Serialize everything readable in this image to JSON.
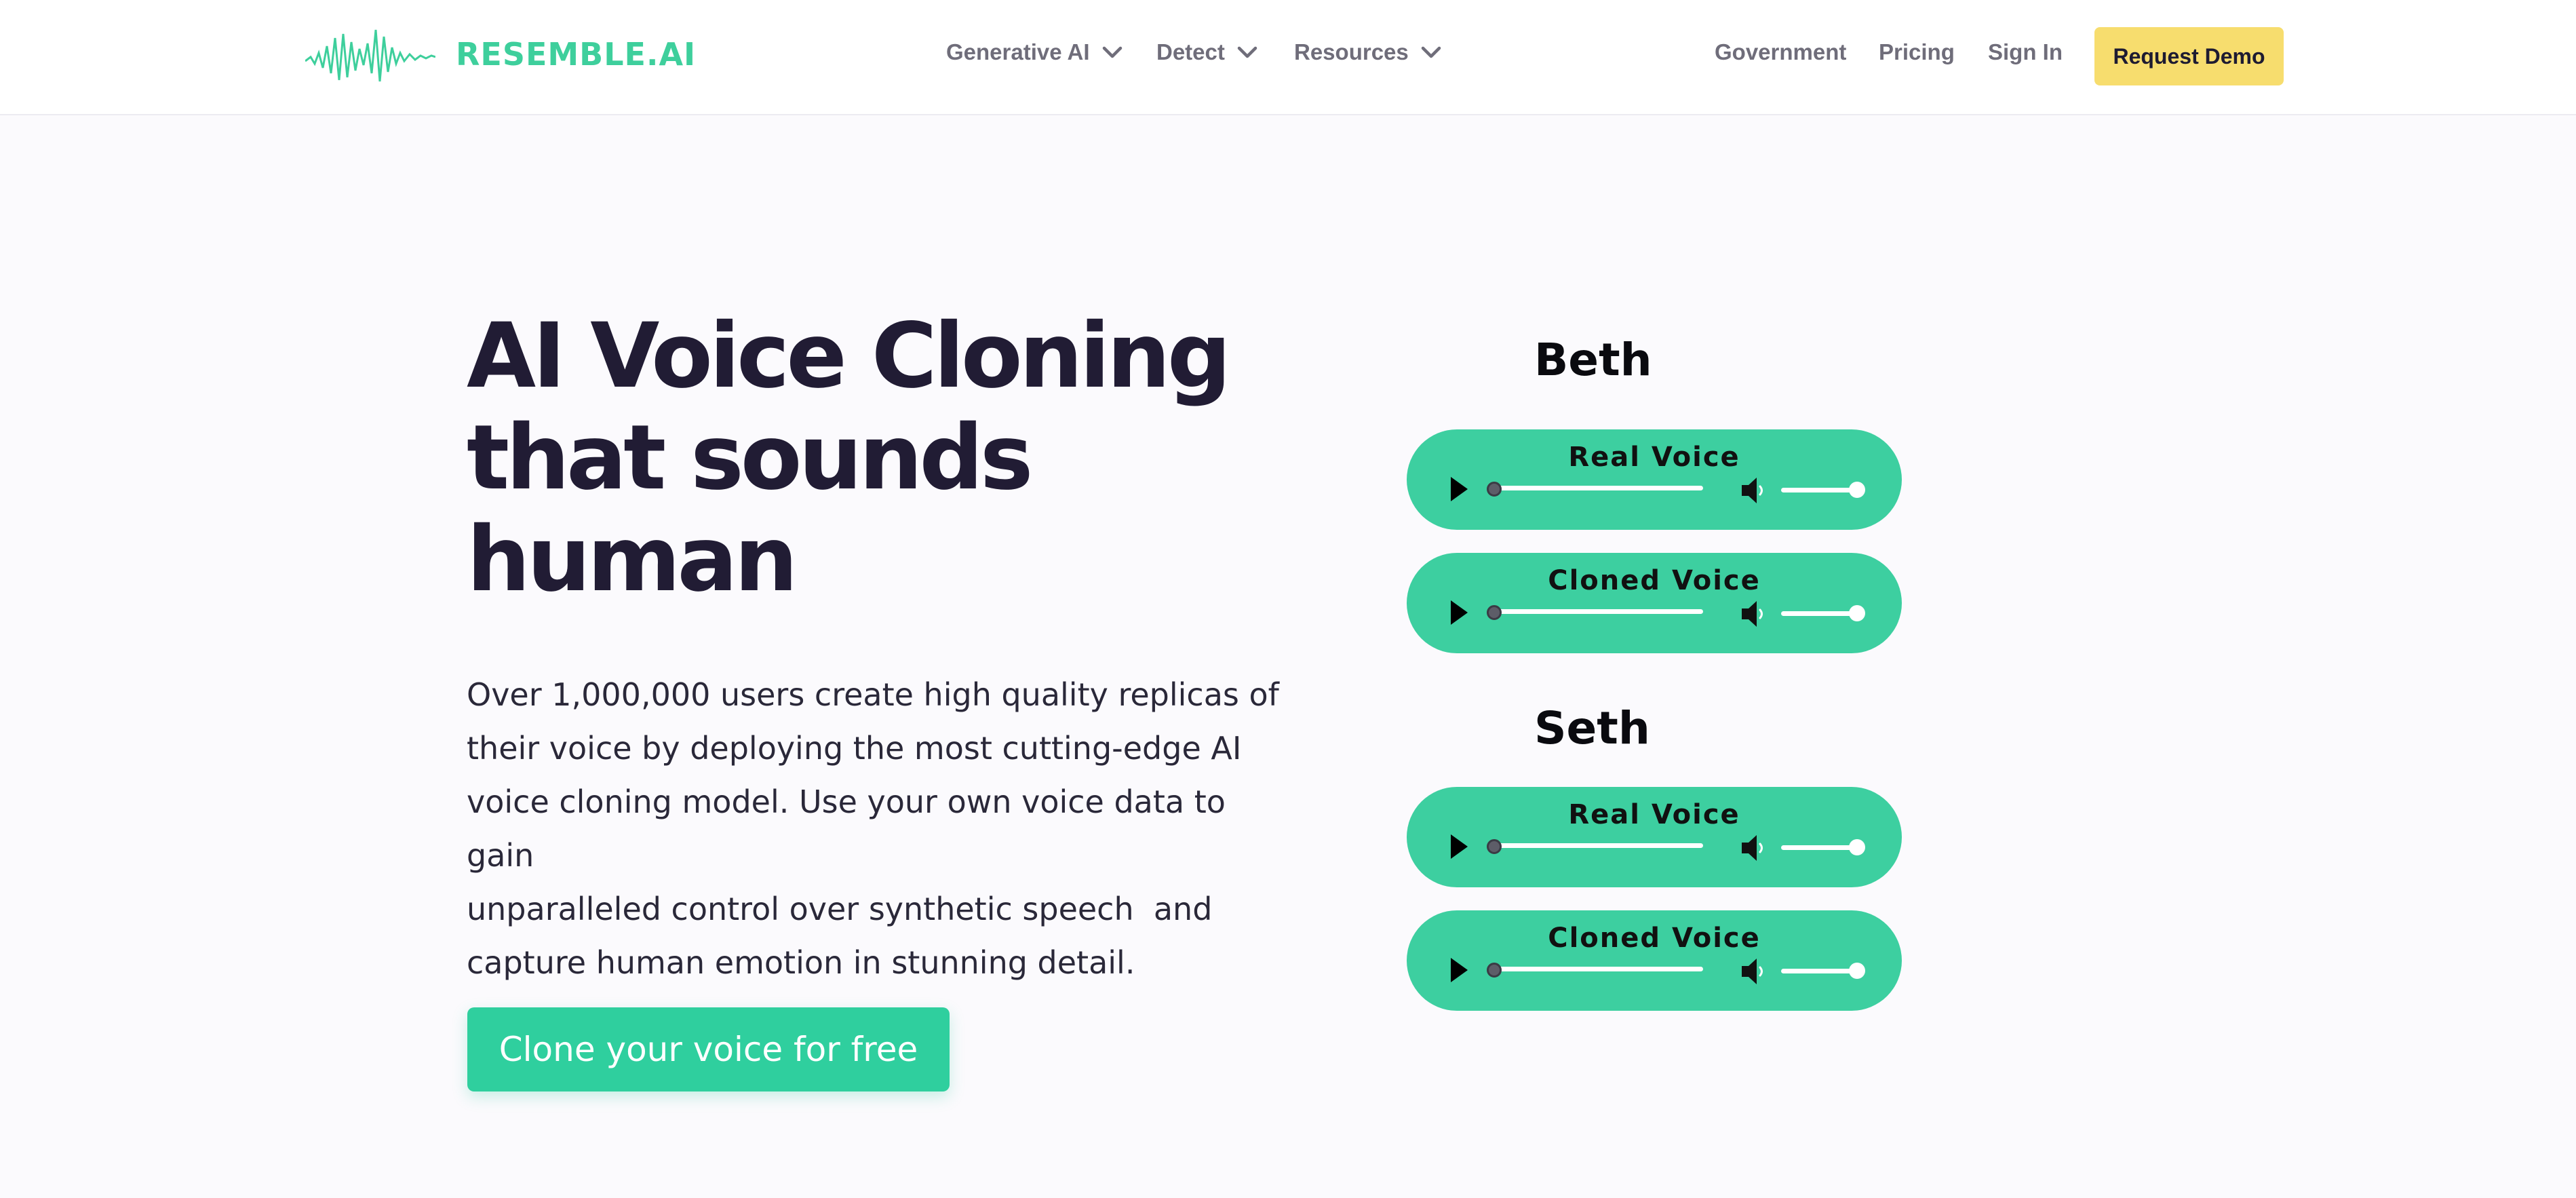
{
  "brand": {
    "name": "RESEMBLE.AI",
    "accent_color": "#3ecf9c"
  },
  "nav": {
    "menus": [
      {
        "label": "Generative AI",
        "icon": "chevron-down-icon"
      },
      {
        "label": "Detect",
        "icon": "chevron-down-icon"
      },
      {
        "label": "Resources",
        "icon": "chevron-down-icon"
      }
    ],
    "links": [
      "Government",
      "Pricing",
      "Sign In"
    ],
    "cta_label": "Request Demo",
    "cta_color": "#f7dd6e"
  },
  "hero": {
    "title_lines": [
      "AI Voice Cloning",
      "that sounds",
      "human"
    ],
    "description_lines": [
      "Over 1,000,000 users create high quality replicas of",
      "their voice by deploying the most cutting-edge AI",
      "voice cloning model. Use your own voice data to gain",
      "unparalleled control over synthetic speech  and",
      "capture human emotion in stunning detail."
    ],
    "cta_label": "Clone your voice for free",
    "cta_color": "#2fcf9e"
  },
  "voices": [
    {
      "speaker": "Beth",
      "players": [
        {
          "label": "Real Voice",
          "progress": 0,
          "volume": 1.0
        },
        {
          "label": "Cloned Voice",
          "progress": 0,
          "volume": 1.0
        }
      ]
    },
    {
      "speaker": "Seth",
      "players": [
        {
          "label": "Real Voice",
          "progress": 0,
          "volume": 1.0
        },
        {
          "label": "Cloned Voice",
          "progress": 0,
          "volume": 1.0
        }
      ]
    }
  ],
  "player_color": "#3dcfa0"
}
